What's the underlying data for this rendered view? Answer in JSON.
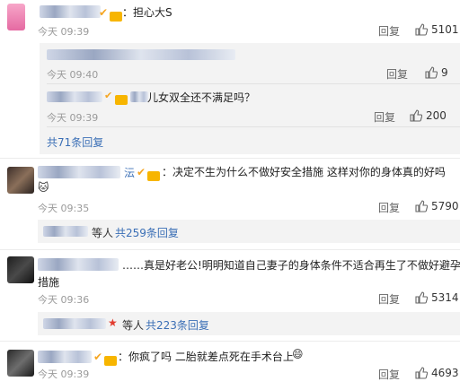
{
  "c1": {
    "text": "：担心大S",
    "time": "今天 09:39",
    "reply": "回复",
    "likes": "5101"
  },
  "c1_sub1": {
    "time": "今天 09:40",
    "reply": "回复",
    "likes": "9"
  },
  "c1_sub2": {
    "text": "儿女双全还不满足吗？",
    "time": "今天 09:39",
    "reply": "回复",
    "likes": "200"
  },
  "c1_total": "共71条回复",
  "c2": {
    "name_tail": "沄",
    "text": "：决定不生为什么不做好安全措施 这样对你的身体真的好吗",
    "time": "今天 09:35",
    "reply": "回复",
    "likes": "5790",
    "sub_prefix": "等人",
    "sub_count": "共259条回复"
  },
  "c3": {
    "text1": "……真是好老公!明明知道自己妻子的身体条件不适合再生了不做好避孕",
    "text2": "措施",
    "time": "今天 09:36",
    "reply": "回复",
    "likes": "5314",
    "sub_prefix": "等人",
    "sub_count": "共223条回复"
  },
  "c4": {
    "text": "：你疯了吗 二胎就差点死在手术台上",
    "time": "今天 09:39",
    "reply": "回复",
    "likes": "4693"
  },
  "colors": {
    "link": "#3b6fb6",
    "badge": "#f5a623"
  }
}
